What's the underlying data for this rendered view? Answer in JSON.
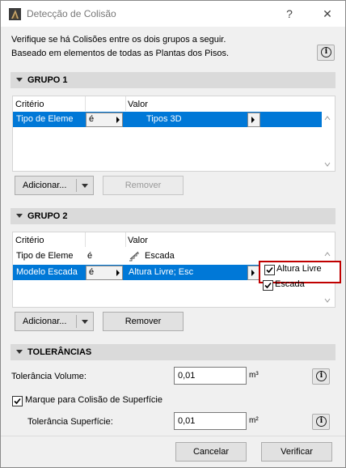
{
  "window": {
    "title": "Detecção de Colisão",
    "help_label": "?",
    "close_label": "✕"
  },
  "intro": {
    "line1": "Verifique se há Colisões entre os dois grupos a seguir.",
    "line2": "Baseado em elementos de todas as Plantas dos Pisos."
  },
  "group1": {
    "header": "GRUPO 1",
    "col_criterio": "Critério",
    "col_valor": "Valor",
    "rows": [
      {
        "criterio": "Tipo de Eleme",
        "operator": "é",
        "valor": "Tipos 3D"
      }
    ],
    "add_label": "Adicionar...",
    "remove_label": "Remover"
  },
  "group2": {
    "header": "GRUPO 2",
    "col_criterio": "Critério",
    "col_valor": "Valor",
    "rows": [
      {
        "criterio": "Tipo de Eleme",
        "operator": "é",
        "valor": "Escada"
      },
      {
        "criterio": "Modelo Escada",
        "operator": "é",
        "valor": "Altura Livre; Esc"
      }
    ],
    "add_label": "Adicionar...",
    "remove_label": "Remover"
  },
  "popup": {
    "options": [
      {
        "label": "Altura Livre",
        "checked": true
      },
      {
        "label": "Escada",
        "checked": true
      }
    ]
  },
  "tolerances": {
    "header": "TOLERÂNCIAS",
    "volume_label": "Tolerância Volume:",
    "volume_value": "0,01",
    "volume_unit": "m³",
    "surface_check_label": "Marque para Colisão de Superfície",
    "surface_checked": true,
    "surface_label": "Tolerância Superfície:",
    "surface_value": "0,01",
    "surface_unit": "m²"
  },
  "footer": {
    "cancel_label": "Cancelar",
    "verify_label": "Verificar"
  },
  "colors": {
    "selection": "#0078d7",
    "highlight_border": "#c00000"
  }
}
